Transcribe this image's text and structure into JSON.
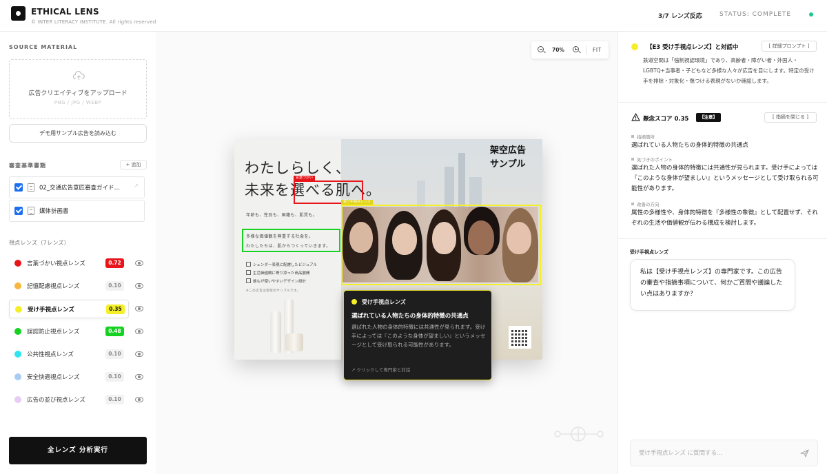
{
  "header": {
    "title": "ETHICAL LENS",
    "subtitle": "© INTER LITERACY INSTITUTE. All rights reserved",
    "lens_count": "3/7 レンズ反応",
    "status": "STATUS: COMPLETE",
    "status_color": "#1ec88a"
  },
  "source": {
    "section_label": "SOURCE MATERIAL",
    "upload_text": "広告クリエイティブをアップロード",
    "upload_formats": "PNG / JPG / WEBP",
    "demo_button": "デモ用サンプル広告を読み込む"
  },
  "criteria": {
    "section_label": "審査基準書類",
    "add_button": "+ 追加",
    "documents": [
      {
        "label": "02_交通広告意匠審査ガイド…",
        "checked": true
      },
      {
        "label": "媒体計画書",
        "checked": true
      }
    ]
  },
  "lenses": {
    "section_label": "視点レンズ（7レンズ）",
    "items": [
      {
        "label": "言葉づかい視点レンズ",
        "score": "0.72",
        "color": "#e8161b",
        "badge_bg": "#e8161b",
        "badge_fg": "#ffffff",
        "active": false
      },
      {
        "label": "記憶配慮視点レンズ",
        "score": "0.10",
        "color": "#f6b73c",
        "badge_bg": "#f2f2f2",
        "badge_fg": "#888888",
        "active": false
      },
      {
        "label": "受け手視点レンズ",
        "score": "0.35",
        "color": "#f5ef2a",
        "badge_bg": "#f5ef2a",
        "badge_fg": "#111111",
        "active": true
      },
      {
        "label": "誤認防止視点レンズ",
        "score": "0.48",
        "color": "#14d21f",
        "badge_bg": "#14d21f",
        "badge_fg": "#ffffff",
        "active": false
      },
      {
        "label": "公共性視点レンズ",
        "score": "0.10",
        "color": "#2ee6f0",
        "badge_bg": "#f2f2f2",
        "badge_fg": "#888888",
        "active": false
      },
      {
        "label": "安全快適視点レンズ",
        "score": "0.10",
        "color": "#a9cdf2",
        "badge_bg": "#f2f2f2",
        "badge_fg": "#888888",
        "active": false
      },
      {
        "label": "広告の並び視点レンズ",
        "score": "0.10",
        "color": "#e6cdf4",
        "badge_bg": "#f2f2f2",
        "badge_fg": "#888888",
        "active": false
      }
    ]
  },
  "run_button": "全レンズ 分析実行",
  "canvas": {
    "zoom_value": "70%",
    "fit_label": "FIT"
  },
  "ad": {
    "headline_line1": "わたしらしく、",
    "headline_pre": "未来を",
    "headline_highlight": "選べる肌",
    "headline_post": "へ。",
    "corner_line1": "架空広告",
    "corner_line2": "サンプル",
    "copy_line1": "年齢も、性別も、国籍も、肌質も。",
    "copy_line2": "多様な価値観を尊重する社会を。",
    "copy_line3": "わたしたちは、肌からつくっていきます。",
    "checks": [
      "シェンダー表現に配慮したビジュアル",
      "生活価値観に寄り添った商品展開",
      "誰もが使いやすいデザイン設計"
    ],
    "footnote": "※この広告は架空のサンプルです。",
    "red_tag": "言葉づかい",
    "yellow_tag": "受け手視点レンズ"
  },
  "tooltip": {
    "lens_name": "受け手視点レンズ",
    "title": "選ばれている人物たちの身体的特徴の共通点",
    "body": "選ばれた人物の身体的特徴には共通性が見られます。受け手によっては『このような身体が望ましい』というメッセージとして受け取られる可能性があります。",
    "footer": "↗ クリックして専門家と対話"
  },
  "chat": {
    "title": "【E3 受け手視点レンズ】と対話中",
    "detail_button": "[ 詳細プロンプト ]",
    "description": "鉄道空間は「強制視認環境」であり、高齢者・障がい者・外国人・LGBTQ+当事者・子どもなど多様な人々が広告を目にします。特定の受け手を排除・対象化・傷つける表現がないか確認します。"
  },
  "concern": {
    "label": "懸念スコア 0.35",
    "badge": "【注意】",
    "close_button": "[ 指摘を閉じる ]",
    "findings": [
      {
        "label": "指摘箇所",
        "text": "選ばれている人物たちの身体的特徴の共通点"
      },
      {
        "label": "気づきのポイント",
        "text": "選ばれた人物の身体的特徴には共通性が見られます。受け手によっては『このような身体が望ましい』というメッセージとして受け取られる可能性があります。"
      },
      {
        "label": "改善の方向",
        "text": "属性の多様性や、身体的特徴を『多様性の象徴』として配置せず、それぞれの生活や価値観が伝わる構成を検討します。"
      }
    ]
  },
  "assistant": {
    "label": "受け手視点レンズ",
    "message": "私は【受け手視点レンズ】の専門家です。この広告の審査や指摘事項について、何かご質問や議論したい点はありますか？"
  },
  "input": {
    "placeholder": "受け手視点レンズ に質問する..."
  }
}
